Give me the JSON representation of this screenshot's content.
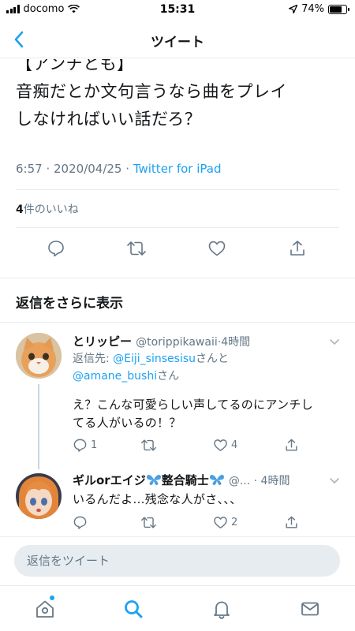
{
  "status_bar": {
    "carrier": "docomo",
    "time": "15:31",
    "battery_percent": "74%",
    "battery_level": 0.74
  },
  "nav": {
    "title": "ツイート"
  },
  "tweet": {
    "text_partial_top": "【アンチとも】",
    "text": "音痴だとか文句言うなら曲をプレイ\nしなければいい話だろ？",
    "time": "6:57",
    "date": "2020/04/25",
    "source": "Twitter for iPad",
    "likes_count": "4",
    "likes_label": "件のいいね"
  },
  "more_replies_label": "返信をさらに表示",
  "replies": [
    {
      "name": "とリッピー",
      "handle": "@torippikawaii",
      "time": "4時間",
      "reply_to_label": "返信先: ",
      "reply_to_1": "@Eiji_sinsesisu",
      "reply_to_mid": "さんと",
      "reply_to_2": "@amane_bushi",
      "reply_to_end": "さん",
      "text": "え？こんな可愛らしい声してるのにアンチし\nてる人がいるの！？",
      "replies": "1",
      "retweets": "",
      "likes": "4"
    },
    {
      "name": "ギルorエイジ",
      "name_suffix": "整合騎士",
      "handle": "@...",
      "time": "4時間",
      "text": "いるんだよ...残念な人がさ、、、",
      "replies": "",
      "retweets": "",
      "likes": "2"
    }
  ],
  "compose": {
    "placeholder": "返信をツイート"
  },
  "colors": {
    "accent": "#1da1f2",
    "secondary_text": "#657786",
    "divider": "#e6ecf0"
  },
  "icons": [
    "back-icon",
    "reply-icon",
    "retweet-icon",
    "like-icon",
    "share-icon",
    "chevron-down-icon",
    "home-icon",
    "search-icon",
    "notifications-icon",
    "messages-icon",
    "butterfly-icon"
  ]
}
